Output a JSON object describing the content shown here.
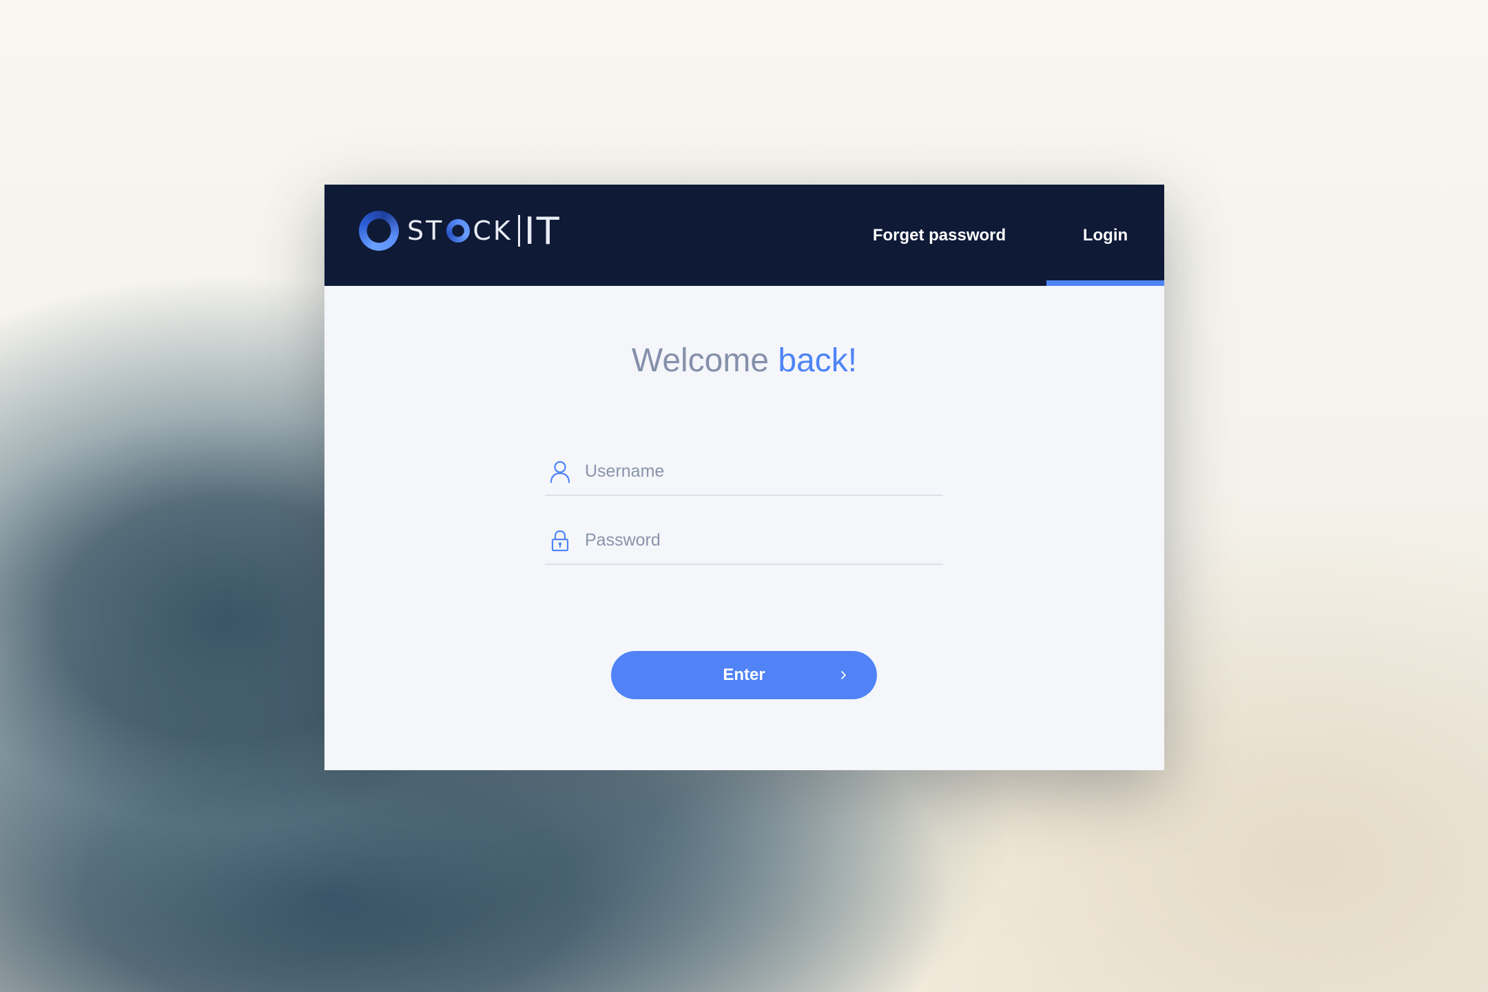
{
  "brand": {
    "logo_prefix": "ST",
    "logo_suffix": "CK",
    "logo_it": "IT"
  },
  "nav": {
    "forget_password": "Forget password",
    "login": "Login",
    "active_tab": "Login"
  },
  "main": {
    "title_plain": "Welcome ",
    "title_accent": "back!"
  },
  "form": {
    "username": {
      "placeholder": "Username",
      "value": "",
      "icon": "user-icon"
    },
    "password": {
      "placeholder": "Password",
      "value": "",
      "icon": "lock-icon"
    },
    "submit_label": "Enter",
    "submit_icon": "chevron-right-icon"
  },
  "colors": {
    "header_bg": "#0f1a37",
    "accent": "#4f84f6",
    "card_bg": "#f4f6fa",
    "muted_text": "#8590ab"
  }
}
